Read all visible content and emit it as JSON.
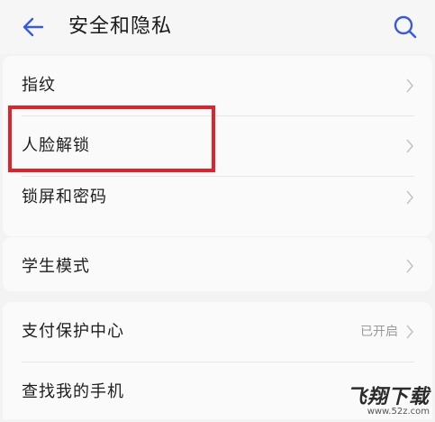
{
  "header": {
    "title": "安全和隐私",
    "back_icon": "back-arrow-icon",
    "search_icon": "search-icon",
    "accent_color": "#3b5bd6"
  },
  "items": [
    {
      "label": "指纹",
      "value": ""
    },
    {
      "label": "人脸解锁",
      "value": ""
    },
    {
      "label": "锁屏和密码",
      "value": ""
    },
    {
      "label": "学生模式",
      "value": ""
    },
    {
      "label": "支付保护中心",
      "value": "已开启"
    },
    {
      "label": "查找我的手机",
      "value": ""
    }
  ],
  "highlight": {
    "color": "#e0232b",
    "target": "人脸解锁"
  },
  "watermark": {
    "title": "飞翔下载",
    "url": "www.52z.com"
  }
}
